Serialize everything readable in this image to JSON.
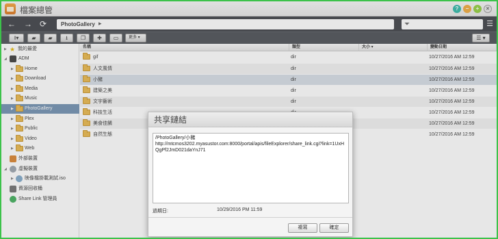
{
  "window": {
    "title": "檔案總管",
    "help_icon": "?",
    "minimize_icon": "−",
    "maximize_icon": "+",
    "close_icon": "×"
  },
  "address_bar": {
    "back_icon": "←",
    "forward_icon": "→",
    "refresh_icon": "⟳",
    "path": "PhotoGallery",
    "path_chevron": "▸",
    "filter_icon": "⏷",
    "menu_icon": "☰"
  },
  "toolbar": {
    "more_label": "更多 ▾",
    "view_icon": "☰ ▾"
  },
  "sidebar": {
    "items": [
      {
        "label": "我的最愛"
      },
      {
        "label": "ADM"
      },
      {
        "label": "Home"
      },
      {
        "label": "Download"
      },
      {
        "label": "Media"
      },
      {
        "label": "Music"
      },
      {
        "label": "PhotoGallery"
      },
      {
        "label": "Plex"
      },
      {
        "label": "Public"
      },
      {
        "label": "Video"
      },
      {
        "label": "Web"
      },
      {
        "label": "外部裝置"
      },
      {
        "label": "虛擬裝置"
      },
      {
        "label": "映像檔掛載測試.iso"
      },
      {
        "label": "資源回收桶"
      },
      {
        "label": "Share Link 管理員"
      }
    ]
  },
  "table": {
    "columns": [
      "名稱",
      "類型",
      "大小 ▾",
      "變動日期"
    ],
    "rows": [
      {
        "name": "gif",
        "type": "dir",
        "size": "",
        "date": "10/27/2016 AM 12:59"
      },
      {
        "name": "人文風情",
        "type": "dir",
        "size": "",
        "date": "10/27/2016 AM 12:59"
      },
      {
        "name": "小豬",
        "type": "dir",
        "size": "",
        "date": "10/27/2016 AM 12:59"
      },
      {
        "name": "建築之美",
        "type": "dir",
        "size": "",
        "date": "10/27/2016 AM 12:59"
      },
      {
        "name": "文宇藝術",
        "type": "dir",
        "size": "",
        "date": "10/27/2016 AM 12:59"
      },
      {
        "name": "科技生活",
        "type": "dir",
        "size": "",
        "date": "10/27/2016 AM 12:59"
      },
      {
        "name": "美食佳餚",
        "type": "dir",
        "size": "",
        "date": "10/27/2016 AM 12:59"
      },
      {
        "name": "自然生態",
        "type": "dir",
        "size": "",
        "date": "10/27/2016 AM 12:59"
      }
    ]
  },
  "dialog": {
    "title": "共享鏈結",
    "link_text": "/PhotoGallery/小豬\nhttp://mtcmos3202.myasustor.com:8000/portal/apis/fileExplorer/share_link.cgi?link=1UxHQgPf2JmD021daYnJ71",
    "expiry_label": "過期日:",
    "expiry_value": "10/29/2016 PM 11:59",
    "copy_label": "複寫",
    "ok_label": "確定"
  },
  "colors": {
    "frame_border": "#3cc24a",
    "address_bar": "#3c3f45",
    "toolbar": "#4a4d53",
    "selected_sidebar": "#6f8fb0",
    "selected_row": "#d6dde6"
  }
}
